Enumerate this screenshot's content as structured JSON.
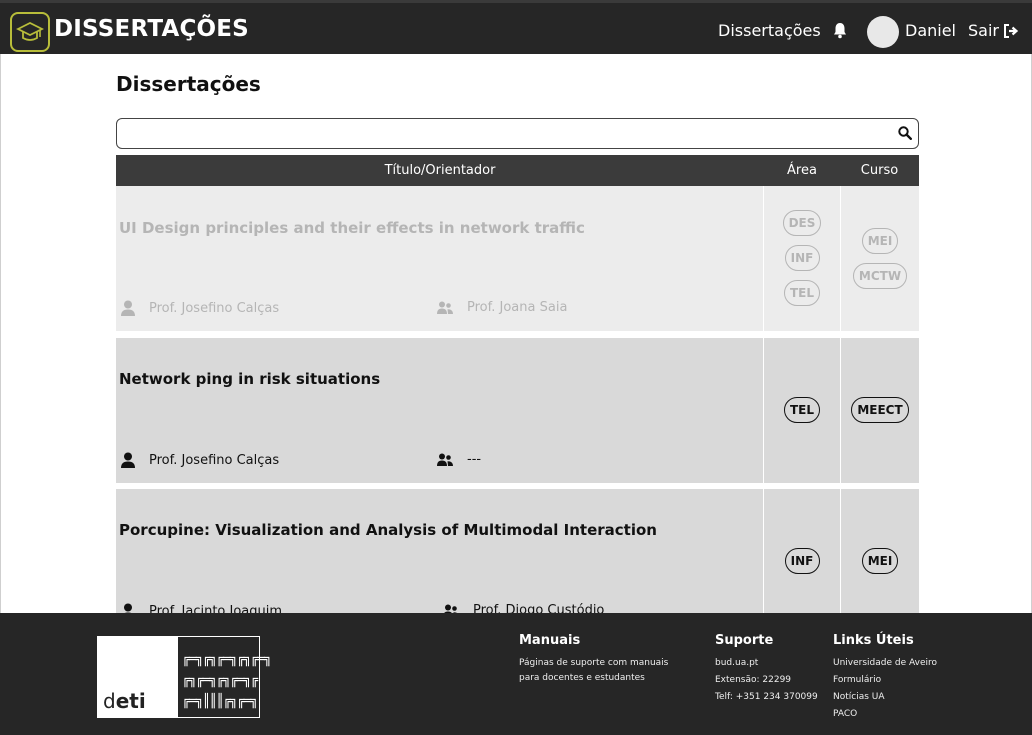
{
  "header": {
    "brand": "DISSERTAÇÕES",
    "nav_link": "Dissertações",
    "user_name": "Daniel",
    "logout_label": "Sair"
  },
  "main": {
    "title": "Dissertações",
    "search": {
      "value": "",
      "placeholder": ""
    },
    "columns": [
      "Título/Orientador",
      "Área",
      "Curso"
    ],
    "rows": [
      {
        "title": "UI Design principles and their effects in network traffic",
        "supervisor": "Prof. Josefino Calças",
        "cosupervisor": "Prof. Joana Saia",
        "areas": [
          "DES",
          "INF",
          "TEL"
        ],
        "courses": [
          "MEI",
          "MCTW"
        ],
        "state": "unavailable"
      },
      {
        "title": "Network ping in risk situations",
        "supervisor": "Prof. Josefino Calças",
        "cosupervisor": "---",
        "areas": [
          "TEL"
        ],
        "courses": [
          "MEECT"
        ],
        "state": "available"
      },
      {
        "title": "Porcupine: Visualization and Analysis of Multimodal Interaction",
        "supervisor": "Prof. Jacinto Joaquim",
        "cosupervisor": "Prof. Diogo Custódio",
        "areas": [
          "INF"
        ],
        "courses": [
          "MEI"
        ],
        "state": "available"
      }
    ]
  },
  "footer": {
    "logo_text": "deti",
    "manuals": {
      "heading": "Manuais",
      "lines": [
        "Páginas de suporte com manuais",
        "para docentes e estudantes"
      ]
    },
    "support": {
      "heading": "Suporte",
      "lines": [
        "bud.ua.pt",
        "Extensão: 22299",
        "Telf: +351 234 370099"
      ]
    },
    "links": {
      "heading": "Links Úteis",
      "items": [
        "Universidade de Aveiro",
        "Formulário",
        "Notícias UA",
        "PACO"
      ]
    }
  },
  "colors": {
    "topbar": "#262626",
    "logo_accent": "#b8bd3a",
    "table_header": "#3b3b3b",
    "row_available": "#d9d9d9",
    "row_unavailable": "#ececec"
  }
}
